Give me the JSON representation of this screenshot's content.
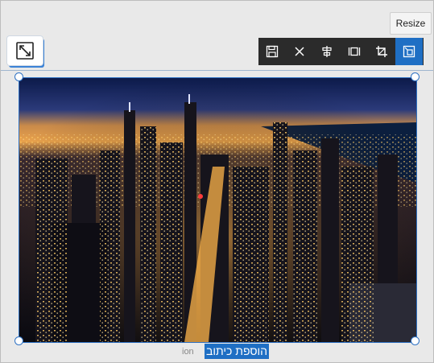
{
  "tooltip": {
    "text": "Resize"
  },
  "toolbar": {
    "buttons": [
      {
        "name": "save-icon"
      },
      {
        "name": "close-icon"
      },
      {
        "name": "align-center-icon"
      },
      {
        "name": "fit-width-icon"
      },
      {
        "name": "crop-icon"
      },
      {
        "name": "resize-icon",
        "active": true
      }
    ],
    "active_color": "#1f6fc4",
    "background_color": "#2b2b2b"
  },
  "image": {
    "subject": "city skyline at night",
    "accent_border": "#2f72c4"
  },
  "caption": {
    "selected_text": "הוספת כיתוב",
    "placeholder_tail": "ion"
  }
}
